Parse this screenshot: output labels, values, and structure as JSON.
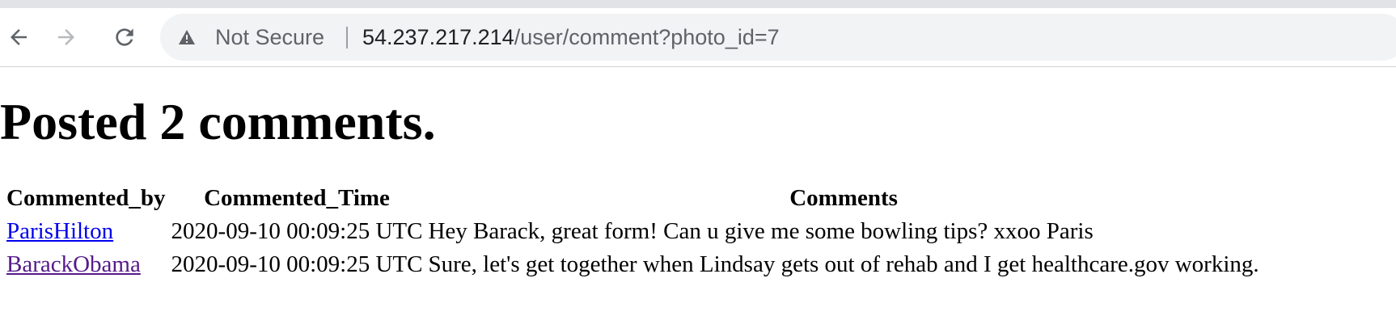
{
  "browser": {
    "security_label": "Not Secure",
    "url_host": "54.237.217.214",
    "url_path": "/user/comment?photo_id=7"
  },
  "page": {
    "title": "Posted 2 comments.",
    "table": {
      "headers": [
        "Commented_by",
        "Commented_Time",
        "Comments"
      ],
      "rows": [
        {
          "user": "ParisHilton",
          "time": "2020-09-10 00:09:25 UTC",
          "comment": "Hey Barack, great form! Can u give me some bowling tips? xxoo Paris"
        },
        {
          "user": "BarackObama",
          "time": "2020-09-10 00:09:25 UTC",
          "comment": "Sure, let's get together when Lindsay gets out of rehab and I get healthcare.gov working."
        }
      ]
    }
  },
  "colors": {
    "link": "#0000ee",
    "visited_link": "#551a8b",
    "omnibox_bg": "#f1f3f4"
  },
  "icons": [
    "back-arrow-icon",
    "forward-arrow-icon",
    "reload-icon",
    "warning-triangle-icon"
  ]
}
